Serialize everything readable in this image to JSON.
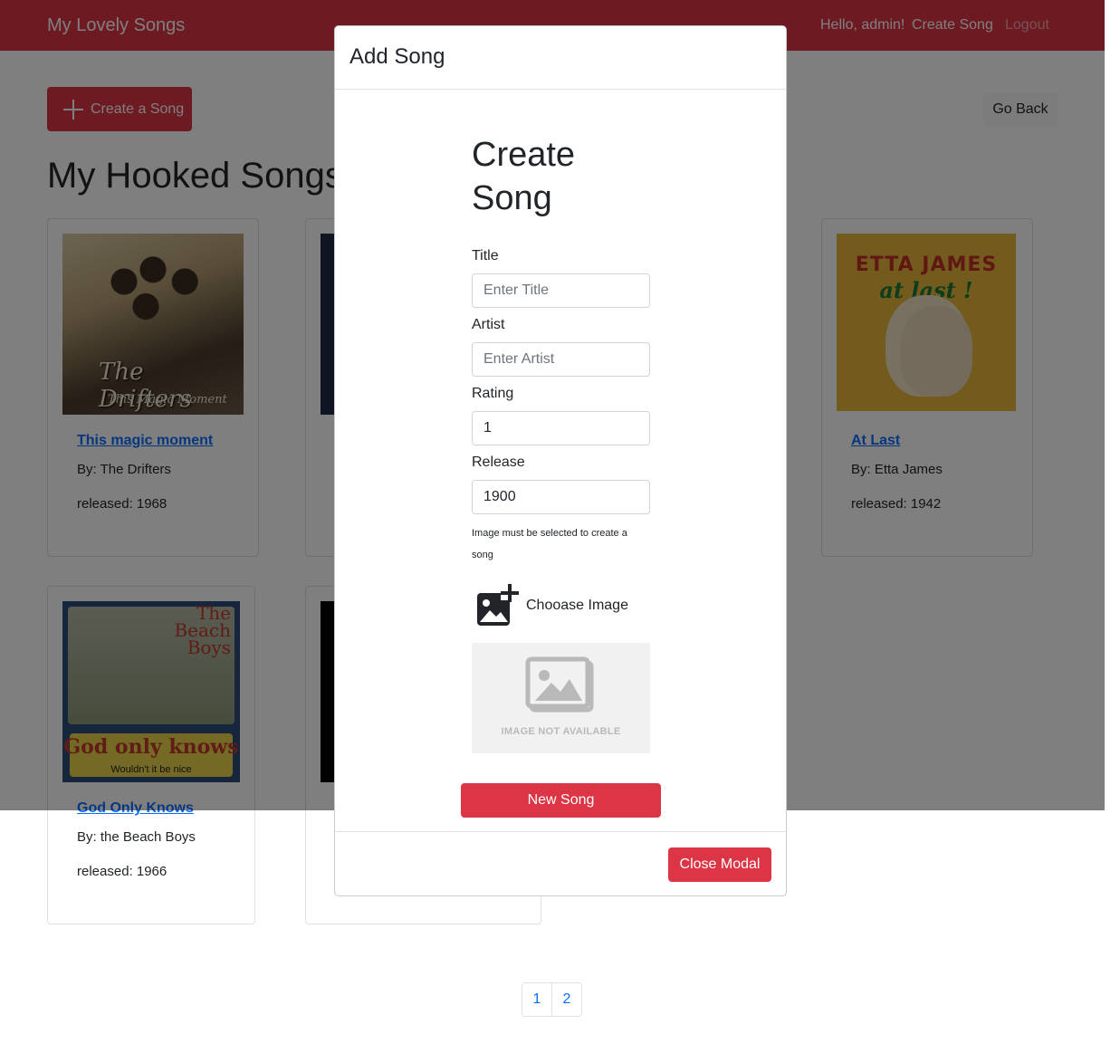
{
  "navbar": {
    "brand": "My Lovely Songs",
    "greeting": "Hello, admin!",
    "create_link": "Create Song",
    "logout_link": "Logout"
  },
  "toolbar": {
    "create_button": "Create a Song",
    "back_button": "Go Back"
  },
  "page": {
    "heading": "My Hooked Songs:"
  },
  "songs": [
    {
      "title": "This magic moment",
      "artist": "By: The Drifters",
      "released": "released: 1968",
      "art_text": "The Drifters",
      "art_subtext": "This Magic Moment"
    },
    {
      "title": "At Last",
      "artist": "By: Etta James",
      "released": "released: 1942",
      "art_text": "ETTA JAMES",
      "art_subtext": "at last !"
    },
    {
      "title": "God Only Knows",
      "artist": "By: the Beach Boys",
      "released": "released: 1966",
      "art_text": "The Beach Boys",
      "art_subtext": "God only knows",
      "art_caption": "Wouldn't it be nice"
    }
  ],
  "modal": {
    "title": "Add Song",
    "form_heading": "Create Song",
    "fields": {
      "title_label": "Title",
      "title_placeholder": "Enter Title",
      "artist_label": "Artist",
      "artist_placeholder": "Enter Artist",
      "rating_label": "Rating",
      "rating_value": "1",
      "release_label": "Release",
      "release_value": "1900"
    },
    "image_note": "Image must be selected to create a song",
    "choose_image": "Chooase Image",
    "image_placeholder_text": "IMAGE NOT AVAILABLE",
    "submit_button": "New Song",
    "close_button": "Close Modal"
  },
  "pagination": {
    "pages": [
      "1",
      "2"
    ]
  },
  "colors": {
    "brand_red": "#dc3545",
    "link_blue": "#0d6efd"
  }
}
